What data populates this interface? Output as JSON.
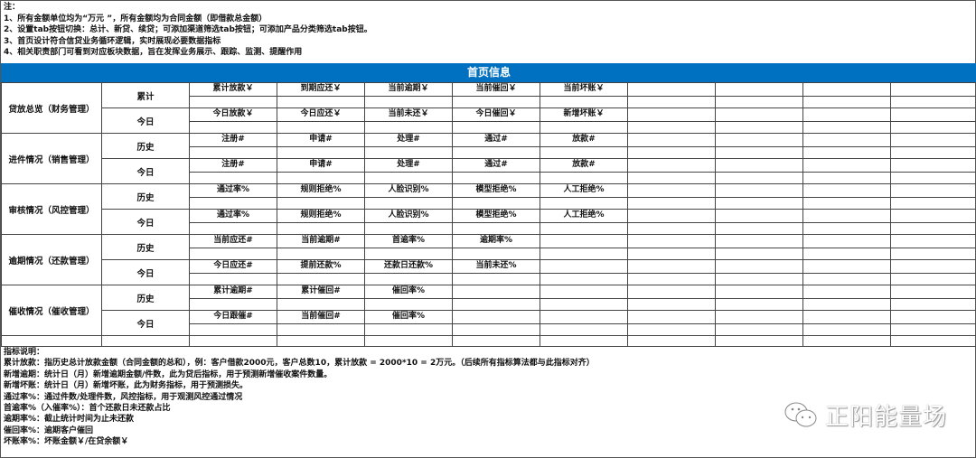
{
  "notes_top": [
    "注：",
    "1、所有金额单位均为“万元 ”，所有金额均为合同金额（即借款总金额）",
    "2、设置tab按钮切换：总计、新贷、续贷；可添加渠道筛选tab按钮；可添加产品分类筛选tab按钮。",
    "3、首页设计符合信贷业务循环逻辑，实时展现必要数据指标",
    "4、相关职责部门可看到对应板块数据，旨在发挥业务展示、跟踪、监测、提醒作用"
  ],
  "title": "首页信息",
  "title_color": "#0070c0",
  "sections": [
    {
      "label": "贷放总览（财务管理）",
      "rows": [
        {
          "label": "累计",
          "cells": [
            "累计放款￥",
            "到期应还￥",
            "当前逾期￥",
            "当前催回￥",
            "当前坏账￥"
          ]
        },
        {
          "label": "今日",
          "cells": [
            "今日放款￥",
            "今日应还￥",
            "当前未还￥",
            "今日催回￥",
            "新增坏账￥"
          ]
        }
      ]
    },
    {
      "label": "进件情况（销售管理）",
      "rows": [
        {
          "label": "历史",
          "cells": [
            "注册#",
            "申请#",
            "处理#",
            "通过#",
            "放款#"
          ]
        },
        {
          "label": "今日",
          "cells": [
            "注册#",
            "申请#",
            "处理#",
            "通过#",
            "放款#"
          ]
        }
      ]
    },
    {
      "label": "审核情况（风控管理）",
      "rows": [
        {
          "label": "历史",
          "cells": [
            "通过率%",
            "规则拒绝%",
            "人脸识别%",
            "模型拒绝%",
            "人工拒绝%"
          ]
        },
        {
          "label": "今日",
          "cells": [
            "通过率%",
            "规则拒绝%",
            "人脸识别%",
            "模型拒绝%",
            "人工拒绝%"
          ]
        }
      ]
    },
    {
      "label": "逾期情况（还款管理）",
      "rows": [
        {
          "label": "历史",
          "cells": [
            "当前应还#",
            "当前逾期#",
            "首逾率%",
            "逾期率%"
          ]
        },
        {
          "label": "今日",
          "cells": [
            "今日应还#",
            "提前还款%",
            "还款日还款%",
            "当前未还%"
          ]
        }
      ]
    },
    {
      "label": "催收情况（催收管理）",
      "rows": [
        {
          "label": "历史",
          "cells": [
            "累计逾期#",
            "累计催回#",
            "催回率%"
          ]
        },
        {
          "label": "今日",
          "cells": [
            "今日跟催#",
            "当前催回#",
            "催回率%"
          ]
        }
      ]
    }
  ],
  "notes_bottom": [
    "指标说明：",
    "累计放款：指历史总计放款金额（合同金额的总和），例：客户借款2000元，客户总数10，累计放款 = 2000*10 = 2万元。（后续所有指标算法都与此指标对齐）",
    "新增逾期：统计日（月）新增逾期金额/件数，此为贷后指标，用于预测新增催收案件数量。",
    "新增坏账：统计日（月）新增坏账，此为财务指标，用于预测损失。",
    "通过率%：通过件数/处理件数，风控指标，用于观测风控通过情况",
    "首逾率%（入催率%）：首个还款日未还款占比",
    "逾期率%：截止统计时间为止未还款",
    "催回率%：逾期客户催回",
    "坏账率%：坏账金额￥/在贷余额￥"
  ],
  "watermark": "正阳能量场"
}
